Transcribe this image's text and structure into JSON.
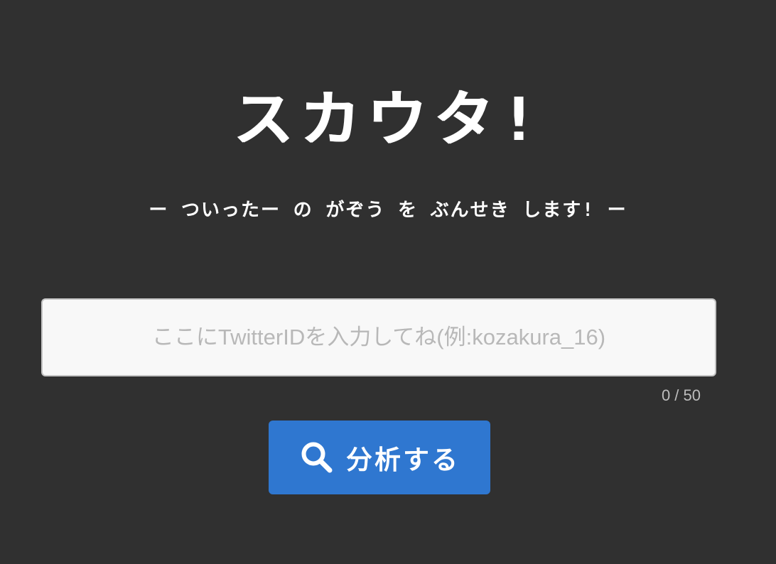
{
  "header": {
    "logo_text": "スカウタ!",
    "tagline": "ー ついったー の がぞう を ぶんせき します! ー"
  },
  "search": {
    "placeholder": "ここにTwitterIDを入力してね(例:kozakura_16)",
    "value": "",
    "char_count": "0 / 50",
    "max_length": 50
  },
  "action": {
    "button_label": "分析する",
    "icon": "search-icon",
    "color": "#2f77d0"
  },
  "theme": {
    "background": "#303030",
    "text": "#ffffff"
  }
}
